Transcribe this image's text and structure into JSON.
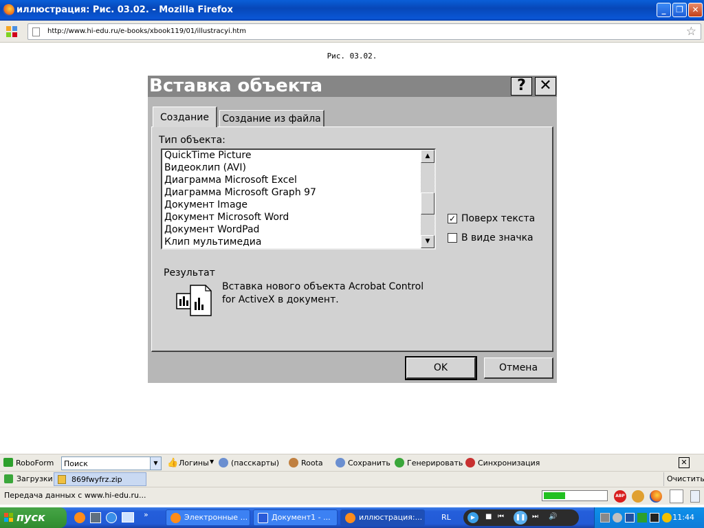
{
  "window": {
    "title": "иллюстрация: Рис. 03.02. - Mozilla Firefox",
    "url": "http://www.hi-edu.ru/e-books/xbook119/01/illustracyi.htm"
  },
  "page": {
    "caption": "Рис. 03.02."
  },
  "dialog": {
    "title": "Вставка объекта",
    "help_label": "?",
    "close_label": "✕",
    "tabs": [
      {
        "label": "Создание",
        "active": true
      },
      {
        "label": "Создание из файла",
        "active": false
      }
    ],
    "type_label": "Тип объекта:",
    "object_types": [
      "QuickTime Picture",
      "Видеоклип (AVI)",
      "Диаграмма Microsoft Excel",
      "Диаграмма Microsoft Graph 97",
      "Документ Image",
      "Документ Microsoft Word",
      "Документ WordPad",
      "Клип мультимедиа"
    ],
    "float_over_text": {
      "label": "Поверх текста",
      "checked": true
    },
    "display_as_icon": {
      "label": "В виде значка",
      "checked": false
    },
    "result_label": "Результат",
    "result_text_line1": "Вставка нового объекта Acrobat Control",
    "result_text_line2": "for ActiveX в документ.",
    "ok_label": "OK",
    "cancel_label": "Отмена"
  },
  "roboform": {
    "name": "RoboForm",
    "search_placeholder": "Поиск",
    "logins": "Логины",
    "passcards": "(пасскарты)",
    "roota": "Roota",
    "save": "Сохранить",
    "generate": "Генерировать",
    "sync": "Синхронизация"
  },
  "downloads": {
    "label": "Загрузки",
    "file": "869fwyfrz.zip",
    "clear": "Очистить"
  },
  "status": {
    "text": "Передача данных с www.hi-edu.ru...",
    "progress": 0.35
  },
  "taskbar": {
    "start": "пуск",
    "tasks": [
      {
        "label": "Электронные ...",
        "active": false
      },
      {
        "label": "Документ1 - ...",
        "active": false
      },
      {
        "label": "иллюстрация:...",
        "active": true
      }
    ],
    "lang": "RL",
    "clock": "11:44"
  }
}
